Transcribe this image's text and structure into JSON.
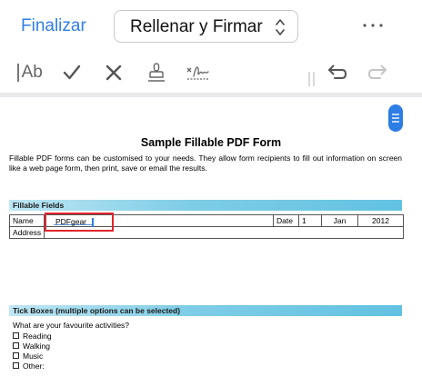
{
  "nav": {
    "done_label": "Finalizar",
    "mode_label": "Rellenar y Firmar",
    "accent_color": "#2f7ee6"
  },
  "toolbar": {
    "text_tool_label": "Ab",
    "tools": [
      "text-tool",
      "checkmark-tool",
      "cross-tool",
      "stamp-tool",
      "signature-tool",
      "undo",
      "redo"
    ]
  },
  "document": {
    "title": "Sample Fillable PDF Form",
    "intro": "Fillable PDF forms can be customised to your needs. They allow form recipients to fill out information on screen like a web page form, then print, save or email the results.",
    "fields_section": {
      "heading": "Fillable Fields",
      "name_label": "Name",
      "name_value": "PDFgear",
      "date_label": "Date",
      "date_day": "1",
      "date_month": "Jan",
      "date_year": "2012",
      "address_label": "Address"
    },
    "tick_section": {
      "heading": "Tick Boxes (multiple options can be selected)",
      "question": "What are your favourite activities?",
      "options": [
        "Reading",
        "Walking",
        "Music",
        "Other:"
      ]
    }
  }
}
